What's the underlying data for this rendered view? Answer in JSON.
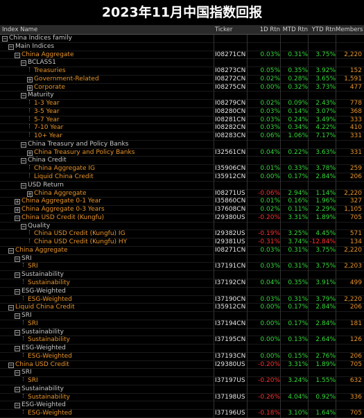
{
  "title": "2023年11月中国指数回报",
  "columns": [
    "Index Name",
    "Ticker",
    "1D Rtn",
    "MTD Rtn",
    "YTD Rtn",
    "Members"
  ],
  "colors": {
    "positive": "#36d93b",
    "negative": "#ff3030",
    "index": "#e8942a",
    "group": "#c8c8c8"
  },
  "rows": [
    {
      "name": "China Indices family",
      "level": 0,
      "type": "group",
      "expander": "minus",
      "ticker": "",
      "d1": "",
      "mtd": "",
      "ytd": "",
      "members": ""
    },
    {
      "name": "Main Indices",
      "level": 1,
      "type": "group",
      "expander": "minus",
      "ticker": "",
      "d1": "",
      "mtd": "",
      "ytd": "",
      "members": ""
    },
    {
      "name": "China Aggregate",
      "level": 2,
      "type": "index",
      "expander": "minus",
      "ticker": "I08271CN",
      "d1": "0.03%",
      "mtd": "0.31%",
      "ytd": "3.75%",
      "members": "2,220"
    },
    {
      "name": "BCLASS1",
      "level": 3,
      "type": "group",
      "expander": "minus",
      "ticker": "",
      "d1": "",
      "mtd": "",
      "ytd": "",
      "members": ""
    },
    {
      "name": "Treasuries",
      "level": 4,
      "type": "index",
      "expander": "",
      "ticker": "I08273CN",
      "d1": "0.05%",
      "mtd": "0.35%",
      "ytd": "3.92%",
      "members": "152"
    },
    {
      "name": "Government-Related",
      "level": 4,
      "type": "index",
      "expander": "plus",
      "ticker": "I08272CN",
      "d1": "0.02%",
      "mtd": "0.28%",
      "ytd": "3.65%",
      "members": "1,591"
    },
    {
      "name": "Corporate",
      "level": 4,
      "type": "index",
      "expander": "plus",
      "ticker": "I08275CN",
      "d1": "0.00%",
      "mtd": "0.32%",
      "ytd": "3.73%",
      "members": "477"
    },
    {
      "name": "Maturity",
      "level": 3,
      "type": "group",
      "expander": "minus",
      "ticker": "",
      "d1": "",
      "mtd": "",
      "ytd": "",
      "members": ""
    },
    {
      "name": "1-3 Year",
      "level": 4,
      "type": "index",
      "expander": "",
      "ticker": "I08279CN",
      "d1": "0.02%",
      "mtd": "0.09%",
      "ytd": "2.43%",
      "members": "778"
    },
    {
      "name": "3-5 Year",
      "level": 4,
      "type": "index",
      "expander": "",
      "ticker": "I08280CN",
      "d1": "0.03%",
      "mtd": "0.14%",
      "ytd": "3.07%",
      "members": "368"
    },
    {
      "name": "5-7 Year",
      "level": 4,
      "type": "index",
      "expander": "",
      "ticker": "I08281CN",
      "d1": "0.03%",
      "mtd": "0.24%",
      "ytd": "3.49%",
      "members": "333"
    },
    {
      "name": "7-10 Year",
      "level": 4,
      "type": "index",
      "expander": "",
      "ticker": "I08282CN",
      "d1": "0.03%",
      "mtd": "0.34%",
      "ytd": "4.22%",
      "members": "410"
    },
    {
      "name": "10+ Year",
      "level": 4,
      "type": "index",
      "expander": "",
      "ticker": "I08283CN",
      "d1": "0.06%",
      "mtd": "1.06%",
      "ytd": "7.17%",
      "members": "331"
    },
    {
      "name": "China Treasury and Policy Banks",
      "level": 3,
      "type": "group",
      "expander": "minus",
      "ticker": "",
      "d1": "",
      "mtd": "",
      "ytd": "",
      "members": ""
    },
    {
      "name": "China Treasury and Policy Banks",
      "level": 4,
      "type": "index",
      "expander": "plus",
      "ticker": "I32561CN",
      "d1": "0.04%",
      "mtd": "0.22%",
      "ytd": "3.63%",
      "members": "331"
    },
    {
      "name": "China Credit",
      "level": 3,
      "type": "group",
      "expander": "minus",
      "ticker": "",
      "d1": "",
      "mtd": "",
      "ytd": "",
      "members": ""
    },
    {
      "name": "China Aggregate IG",
      "level": 4,
      "type": "index",
      "expander": "",
      "ticker": "I35906CN",
      "d1": "0.01%",
      "mtd": "0.33%",
      "ytd": "3.78%",
      "members": "259"
    },
    {
      "name": "Liquid China Credit",
      "level": 4,
      "type": "index",
      "expander": "",
      "ticker": "I35912CN",
      "d1": "0.00%",
      "mtd": "0.17%",
      "ytd": "2.84%",
      "members": "206"
    },
    {
      "name": "USD Return",
      "level": 3,
      "type": "group",
      "expander": "minus",
      "ticker": "",
      "d1": "",
      "mtd": "",
      "ytd": "",
      "members": ""
    },
    {
      "name": "China Aggregate",
      "level": 4,
      "type": "index",
      "expander": "plus",
      "ticker": "I08271US",
      "d1": "-0.06%",
      "mtd": "2.94%",
      "ytd": "1.14%",
      "members": "2,220"
    },
    {
      "name": "China Aggregate 0-1 Year",
      "level": 2,
      "type": "index",
      "expander": "plus",
      "ticker": "I35860CN",
      "d1": "0.01%",
      "mtd": "0.16%",
      "ytd": "1.96%",
      "members": "327"
    },
    {
      "name": "China Aggregate 0-3 Years",
      "level": 2,
      "type": "index",
      "expander": "plus",
      "ticker": "I37608CN",
      "d1": "0.02%",
      "mtd": "0.11%",
      "ytd": "2.29%",
      "members": "1,105"
    },
    {
      "name": "China USD Credit (Kungfu)",
      "level": 2,
      "type": "index",
      "expander": "minus",
      "ticker": "I29380US",
      "d1": "-0.20%",
      "mtd": "3.31%",
      "ytd": "1.89%",
      "members": "705"
    },
    {
      "name": "Quality",
      "level": 3,
      "type": "group",
      "expander": "minus",
      "ticker": "",
      "d1": "",
      "mtd": "",
      "ytd": "",
      "members": ""
    },
    {
      "name": "China USD Credit (Kungfu) IG",
      "level": 4,
      "type": "index",
      "expander": "",
      "ticker": "I29382US",
      "d1": "-0.19%",
      "mtd": "3.25%",
      "ytd": "4.45%",
      "members": "571"
    },
    {
      "name": "China USD Credit (Kungfu) HY",
      "level": 4,
      "type": "index",
      "expander": "",
      "ticker": "I29381US",
      "d1": "-0.31%",
      "mtd": "3.74%",
      "ytd": "-12.84%",
      "members": "134"
    },
    {
      "name": "China Aggregate",
      "level": 1,
      "type": "index",
      "expander": "minus",
      "ticker": "I08271CN",
      "d1": "0.03%",
      "mtd": "0.31%",
      "ytd": "3.75%",
      "members": "2,220"
    },
    {
      "name": "SRI",
      "level": 2,
      "type": "group",
      "expander": "minus",
      "ticker": "",
      "d1": "",
      "mtd": "",
      "ytd": "",
      "members": ""
    },
    {
      "name": "SRI",
      "level": 3,
      "type": "index",
      "expander": "",
      "ticker": "I37191CN",
      "d1": "0.03%",
      "mtd": "0.31%",
      "ytd": "3.75%",
      "members": "2,203"
    },
    {
      "name": "Sustainability",
      "level": 2,
      "type": "group",
      "expander": "minus",
      "ticker": "",
      "d1": "",
      "mtd": "",
      "ytd": "",
      "members": ""
    },
    {
      "name": "Sustainability",
      "level": 3,
      "type": "index",
      "expander": "",
      "ticker": "I37192CN",
      "d1": "0.04%",
      "mtd": "0.35%",
      "ytd": "3.91%",
      "members": "499"
    },
    {
      "name": "ESG-Weighted",
      "level": 2,
      "type": "group",
      "expander": "minus",
      "ticker": "",
      "d1": "",
      "mtd": "",
      "ytd": "",
      "members": ""
    },
    {
      "name": "ESG-Weighted",
      "level": 3,
      "type": "index",
      "expander": "",
      "ticker": "I37190CN",
      "d1": "0.03%",
      "mtd": "0.31%",
      "ytd": "3.79%",
      "members": "2,220"
    },
    {
      "name": "Liquid China Credit",
      "level": 1,
      "type": "index",
      "expander": "minus",
      "ticker": "I35912CN",
      "d1": "0.00%",
      "mtd": "0.17%",
      "ytd": "2.84%",
      "members": "206"
    },
    {
      "name": "SRI",
      "level": 2,
      "type": "group",
      "expander": "minus",
      "ticker": "",
      "d1": "",
      "mtd": "",
      "ytd": "",
      "members": ""
    },
    {
      "name": "SRI",
      "level": 3,
      "type": "index",
      "expander": "",
      "ticker": "I37194CN",
      "d1": "0.00%",
      "mtd": "0.17%",
      "ytd": "2.84%",
      "members": "181"
    },
    {
      "name": "Sustainability",
      "level": 2,
      "type": "group",
      "expander": "minus",
      "ticker": "",
      "d1": "",
      "mtd": "",
      "ytd": "",
      "members": ""
    },
    {
      "name": "Sustainability",
      "level": 3,
      "type": "index",
      "expander": "",
      "ticker": "I37195CN",
      "d1": "0.00%",
      "mtd": "0.13%",
      "ytd": "2.64%",
      "members": "126"
    },
    {
      "name": "ESG-Weighted",
      "level": 2,
      "type": "group",
      "expander": "minus",
      "ticker": "",
      "d1": "",
      "mtd": "",
      "ytd": "",
      "members": ""
    },
    {
      "name": "ESG-Weighted",
      "level": 3,
      "type": "index",
      "expander": "",
      "ticker": "I37193CN",
      "d1": "0.00%",
      "mtd": "0.15%",
      "ytd": "2.76%",
      "members": "206"
    },
    {
      "name": "China USD Credit",
      "level": 1,
      "type": "index",
      "expander": "minus",
      "ticker": "I29380US",
      "d1": "-0.20%",
      "mtd": "3.31%",
      "ytd": "1.89%",
      "members": "705"
    },
    {
      "name": "SRI",
      "level": 2,
      "type": "group",
      "expander": "minus",
      "ticker": "",
      "d1": "",
      "mtd": "",
      "ytd": "",
      "members": ""
    },
    {
      "name": "SRI",
      "level": 3,
      "type": "index",
      "expander": "",
      "ticker": "I37197US",
      "d1": "-0.20%",
      "mtd": "3.24%",
      "ytd": "1.55%",
      "members": "632"
    },
    {
      "name": "Sustainability",
      "level": 2,
      "type": "group",
      "expander": "minus",
      "ticker": "",
      "d1": "",
      "mtd": "",
      "ytd": "",
      "members": ""
    },
    {
      "name": "Sustainability",
      "level": 3,
      "type": "index",
      "expander": "",
      "ticker": "I37198US",
      "d1": "-0.26%",
      "mtd": "4.04%",
      "ytd": "0.92%",
      "members": "336"
    },
    {
      "name": "ESG-Weighted",
      "level": 2,
      "type": "group",
      "expander": "minus",
      "ticker": "",
      "d1": "",
      "mtd": "",
      "ytd": "",
      "members": ""
    },
    {
      "name": "ESG-Weighted",
      "level": 3,
      "type": "index",
      "expander": "",
      "ticker": "I37196US",
      "d1": "-0.18%",
      "mtd": "3.10%",
      "ytd": "1.64%",
      "members": "705"
    }
  ]
}
